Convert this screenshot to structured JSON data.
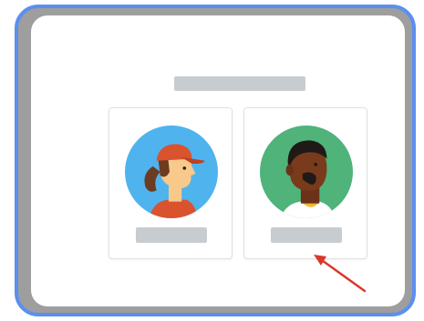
{
  "illustration": {
    "cards": [
      {
        "avatar": "woman-with-cap-avatar",
        "name_label": ""
      },
      {
        "avatar": "man-avatar",
        "name_label": ""
      }
    ],
    "title_label": ""
  },
  "colors": {
    "frame_border": "#5b8ff0",
    "frame_bg": "#9e9e9e",
    "placeholder": "#c8ccd0",
    "avatar_bg_1": "#4fb3ee",
    "avatar_bg_2": "#4fb37a",
    "cap": "#d9532f",
    "arrow": "#d8392c"
  },
  "icons": [
    "woman-avatar-icon",
    "man-avatar-icon",
    "arrow-icon"
  ]
}
